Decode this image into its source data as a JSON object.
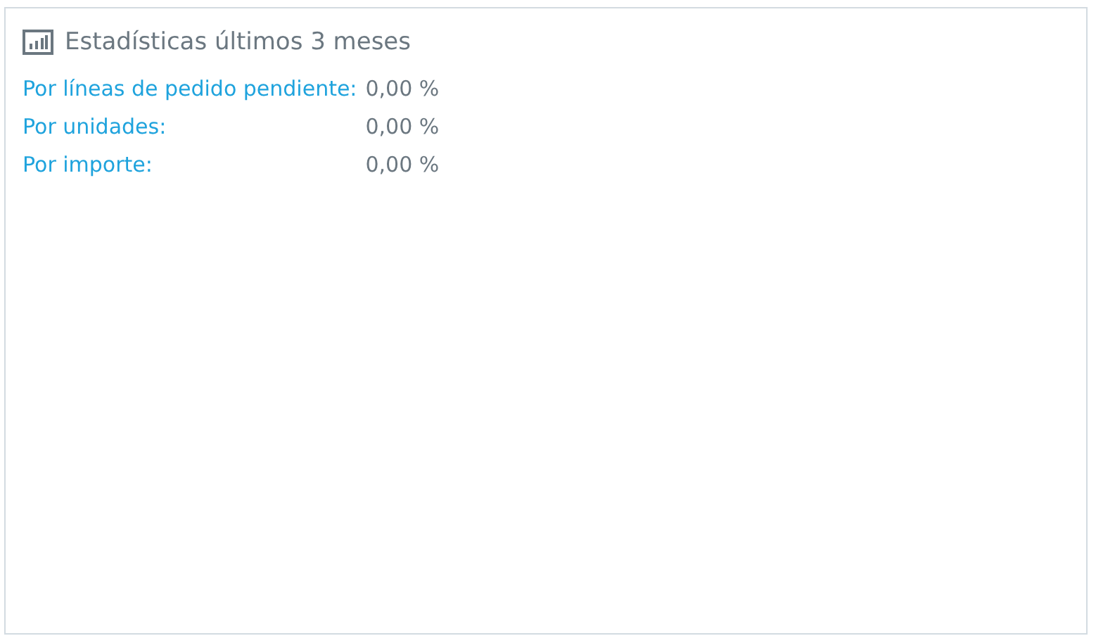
{
  "panel": {
    "title": "Estadísticas últimos 3 meses"
  },
  "stats": [
    {
      "label": "Por líneas de pedido pendiente:",
      "value": "0,00 %"
    },
    {
      "label": "Por unidades:",
      "value": "0,00 %"
    },
    {
      "label": "Por importe:",
      "value": "0,00 %"
    }
  ]
}
